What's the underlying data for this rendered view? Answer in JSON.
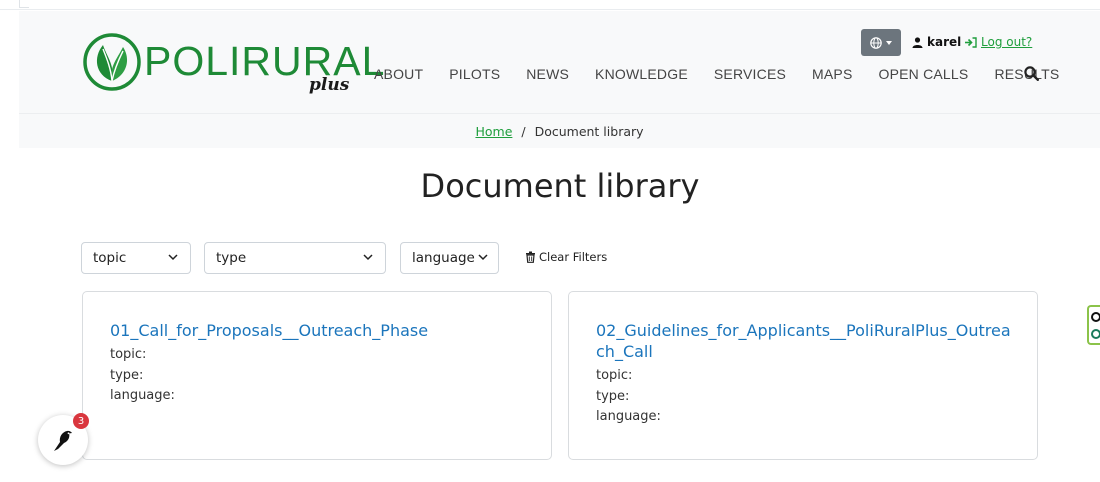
{
  "brand": {
    "name": "POLIRURAL",
    "suffix": "plus"
  },
  "header": {
    "user": "karel",
    "logout": "Log out?",
    "nav": [
      "ABOUT",
      "PILOTS",
      "NEWS",
      "KNOWLEDGE",
      "SERVICES",
      "MAPS",
      "OPEN CALLS",
      "RESULTS"
    ]
  },
  "breadcrumb": {
    "home": "Home",
    "separator": "/",
    "current": "Document library"
  },
  "page": {
    "title": "Document library"
  },
  "filters": {
    "topic": "topic",
    "type": "type",
    "language": "language",
    "clear": "Clear Filters"
  },
  "documents": [
    {
      "title": "01_Call_for_Proposals__Outreach_Phase",
      "topic_label": "topic:",
      "type_label": "type:",
      "language_label": "language:"
    },
    {
      "title": "02_Guidelines_for_Applicants__PoliRuralPlus_Outreach_Call",
      "topic_label": "topic:",
      "type_label": "type:",
      "language_label": "language:"
    }
  ],
  "notifications": {
    "count": "3"
  },
  "colors": {
    "brand_green": "#1e8a36",
    "link_blue": "#1b75bc",
    "badge_red": "#d9363e"
  }
}
